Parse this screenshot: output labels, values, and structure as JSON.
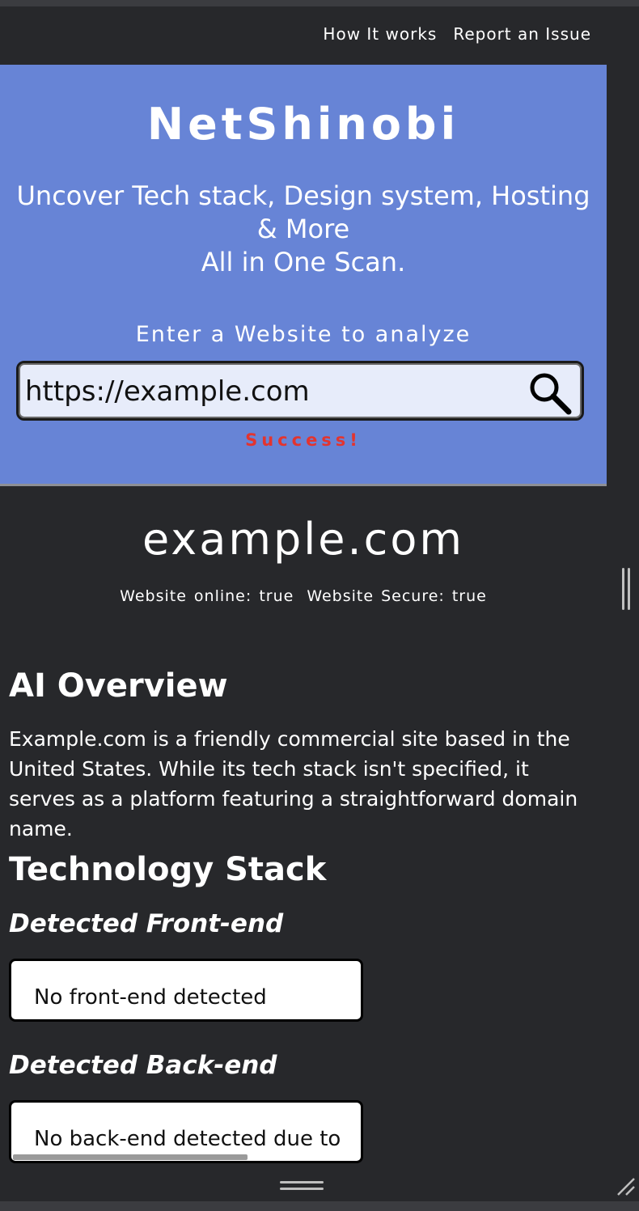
{
  "nav": {
    "how_it_works": "How It works",
    "report_issue": "Report an Issue"
  },
  "hero": {
    "brand": "NetShinobi",
    "tagline_line1": "Uncover Tech stack, Design system, Hosting",
    "tagline_line2": "& More",
    "tagline_line3": "All in One Scan.",
    "prompt": "Enter a Website to analyze",
    "search_value": "https://example.com",
    "status": "Success!"
  },
  "site": {
    "domain": "example.com",
    "online": "Website online: true",
    "secure": "Website Secure: true"
  },
  "overview": {
    "heading": "AI Overview",
    "text": "Example.com is a friendly commercial site based in the United States. While its tech stack isn't specified, it serves as a platform featuring a straightforward domain name."
  },
  "tech": {
    "heading": "Technology Stack",
    "frontend_heading": "Detected Front-end",
    "frontend_value": "No front-end detected",
    "backend_heading": "Detected Back-end",
    "backend_value": "No back-end detected due to"
  },
  "colors": {
    "page_bg": "#27282b",
    "hero_bg": "#6784d6",
    "status": "#e3342f",
    "search_bg": "#e7ecfa"
  }
}
